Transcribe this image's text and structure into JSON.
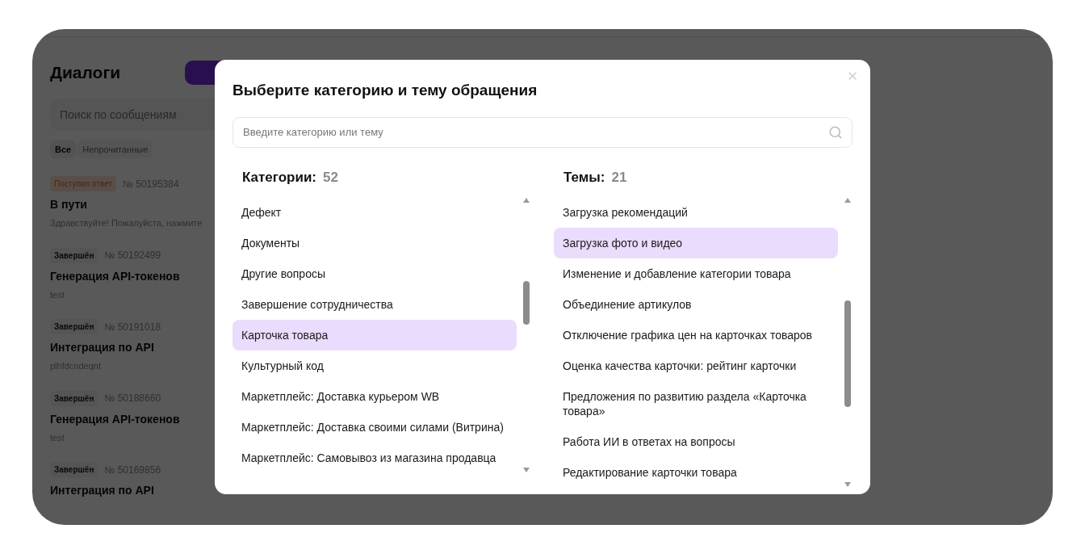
{
  "sidebar": {
    "title": "Диалоги",
    "search": {
      "placeholder": "Поиск по сообщениям"
    },
    "filters": [
      {
        "label": "Все",
        "selected": true
      },
      {
        "label": "Непрочитанные",
        "selected": false
      }
    ],
    "dialogs": [
      {
        "status": "Поступил ответ",
        "kind": "answered",
        "number": "№ 50195384",
        "title": "В пути",
        "preview": "Здравствуйте! Пожалуйста, нажмите"
      },
      {
        "status": "Завершён",
        "kind": "done",
        "number": "№ 50192499",
        "title": "Генерация API-токенов",
        "preview": "test"
      },
      {
        "status": "Завершён",
        "kind": "done",
        "number": "№ 50191018",
        "title": "Интеграция по API",
        "preview": "plhfdcndeqnt"
      },
      {
        "status": "Завершён",
        "kind": "done",
        "number": "№ 50188660",
        "title": "Генерация API-токенов",
        "preview": "test"
      },
      {
        "status": "Завершён",
        "kind": "done",
        "number": "№ 50169856",
        "title": "Интеграция по API"
      }
    ]
  },
  "modal": {
    "title": "Выберите категорию и тему обращения",
    "search": {
      "placeholder": "Введите категорию или тему"
    },
    "categories": {
      "heading": "Категории:",
      "count": "52",
      "items": [
        {
          "label": "Дефект",
          "selected": false
        },
        {
          "label": "Документы",
          "selected": false
        },
        {
          "label": "Другие вопросы",
          "selected": false
        },
        {
          "label": "Завершение сотрудничества",
          "selected": false
        },
        {
          "label": "Карточка товара",
          "selected": true
        },
        {
          "label": "Культурный код",
          "selected": false
        },
        {
          "label": "Маркетплейс: Доставка курьером WB",
          "selected": false
        },
        {
          "label": "Маркетплейс: Доставка своими силами (Витрина)",
          "selected": false
        },
        {
          "label": "Маркетплейс: Самовывоз из магазина продавца",
          "selected": false
        }
      ]
    },
    "topics": {
      "heading": "Темы:",
      "count": "21",
      "items": [
        {
          "label": "Загрузка рекомендаций",
          "selected": false
        },
        {
          "label": "Загрузка фото и видео",
          "selected": true
        },
        {
          "label": "Изменение и добавление категории товара",
          "selected": false
        },
        {
          "label": "Объединение артикулов",
          "selected": false
        },
        {
          "label": "Отключение графика цен на карточках товаров",
          "selected": false
        },
        {
          "label": "Оценка качества карточки: рейтинг карточки",
          "selected": false
        },
        {
          "label": "Предложения по развитию раздела «Карточка товара»",
          "selected": false
        },
        {
          "label": "Работа ИИ в ответах на вопросы",
          "selected": false
        },
        {
          "label": "Редактирование карточки товара",
          "selected": false
        }
      ]
    }
  }
}
